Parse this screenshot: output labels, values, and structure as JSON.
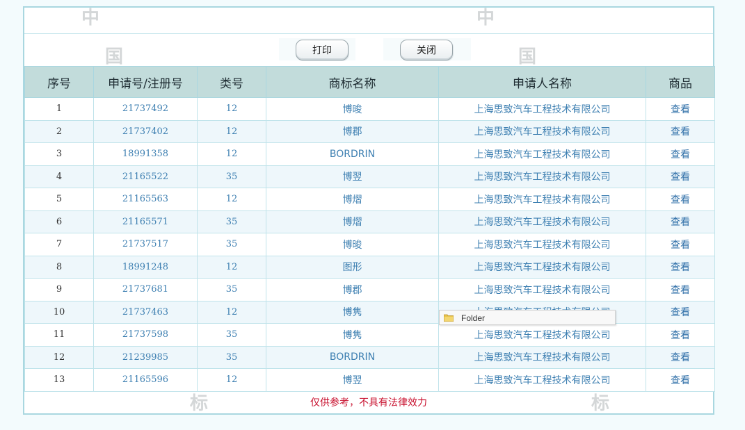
{
  "toolbar": {
    "print_label": "打印",
    "close_label": "关闭"
  },
  "table": {
    "headers": [
      "序号",
      "申请号/注册号",
      "类号",
      "商标名称",
      "申请人名称",
      "商品"
    ],
    "rows": [
      {
        "seq": "1",
        "reg_no": "21737492",
        "class": "12",
        "name": "博晙",
        "applicant": "上海思致汽车工程技术有限公司",
        "action": "查看"
      },
      {
        "seq": "2",
        "reg_no": "21737402",
        "class": "12",
        "name": "博郡",
        "applicant": "上海思致汽车工程技术有限公司",
        "action": "查看"
      },
      {
        "seq": "3",
        "reg_no": "18991358",
        "class": "12",
        "name": "BORDRIN",
        "applicant": "上海思致汽车工程技术有限公司",
        "action": "查看"
      },
      {
        "seq": "4",
        "reg_no": "21165522",
        "class": "35",
        "name": "博翌",
        "applicant": "上海思致汽车工程技术有限公司",
        "action": "查看"
      },
      {
        "seq": "5",
        "reg_no": "21165563",
        "class": "12",
        "name": "博熠",
        "applicant": "上海思致汽车工程技术有限公司",
        "action": "查看"
      },
      {
        "seq": "6",
        "reg_no": "21165571",
        "class": "35",
        "name": "博熠",
        "applicant": "上海思致汽车工程技术有限公司",
        "action": "查看"
      },
      {
        "seq": "7",
        "reg_no": "21737517",
        "class": "35",
        "name": "博晙",
        "applicant": "上海思致汽车工程技术有限公司",
        "action": "查看"
      },
      {
        "seq": "8",
        "reg_no": "18991248",
        "class": "12",
        "name": "图形",
        "applicant": "上海思致汽车工程技术有限公司",
        "action": "查看"
      },
      {
        "seq": "9",
        "reg_no": "21737681",
        "class": "35",
        "name": "博郡",
        "applicant": "上海思致汽车工程技术有限公司",
        "action": "查看"
      },
      {
        "seq": "10",
        "reg_no": "21737463",
        "class": "12",
        "name": "博隽",
        "applicant": "上海思致汽车工程技术有限公司",
        "action": "查看"
      },
      {
        "seq": "11",
        "reg_no": "21737598",
        "class": "35",
        "name": "博隽",
        "applicant": "上海思致汽车工程技术有限公司",
        "action": "查看"
      },
      {
        "seq": "12",
        "reg_no": "21239985",
        "class": "35",
        "name": "BORDRIN",
        "applicant": "上海思致汽车工程技术有限公司",
        "action": "查看"
      },
      {
        "seq": "13",
        "reg_no": "21165596",
        "class": "12",
        "name": "博翌",
        "applicant": "上海思致汽车工程技术有限公司",
        "action": "查看"
      }
    ]
  },
  "footer": {
    "disclaimer": "仅供参考，不具有法律效力"
  },
  "tooltip": {
    "label": "Folder",
    "icon": "folder-icon"
  },
  "watermarks": [
    "中",
    "国",
    "中",
    "国",
    "标",
    "标"
  ],
  "colors": {
    "frame_border": "#a9d7e0",
    "header_bg": "#c2dcdb",
    "link_text": "#3d7fb1",
    "row_alt_bg": "#eef7fb",
    "disclaimer": "#c8102e"
  }
}
